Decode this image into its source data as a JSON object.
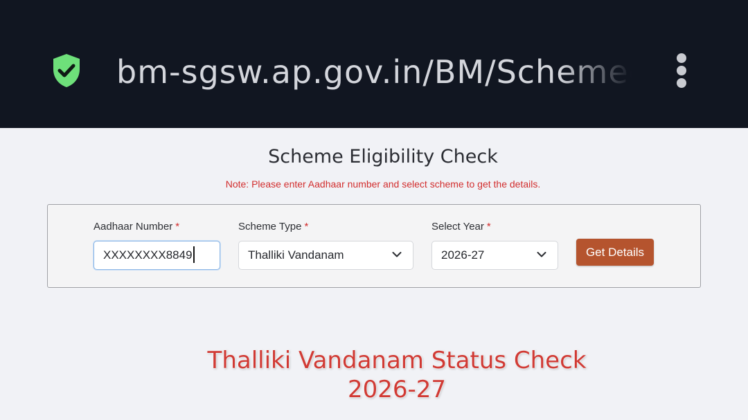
{
  "browser": {
    "url": "bm-sgsw.ap.gov.in/BM/Schemeel",
    "secure_icon": "shield-check-icon",
    "menu_icon": "vertical-dots-icon",
    "shield_color": "#6ee07a"
  },
  "page": {
    "title": "Scheme Eligibility Check",
    "note": "Note: Please enter Aadhaar number and select scheme to get the details."
  },
  "form": {
    "aadhaar": {
      "label": "Aadhaar Number",
      "required_mark": "*",
      "value": "XXXXXXXX8849"
    },
    "scheme_type": {
      "label": "Scheme Type",
      "required_mark": "*",
      "selected": "Thalliki Vandanam"
    },
    "year": {
      "label": "Select Year",
      "required_mark": "*",
      "selected": "2026-27"
    },
    "submit_label": "Get Details"
  },
  "overlay": {
    "line1": "Thalliki Vandanam Status Check",
    "line2": "2026-27"
  },
  "colors": {
    "topbar": "#111621",
    "accent_button": "#b5542e",
    "required": "#d22d2d",
    "overlay_text": "#d13a34"
  }
}
